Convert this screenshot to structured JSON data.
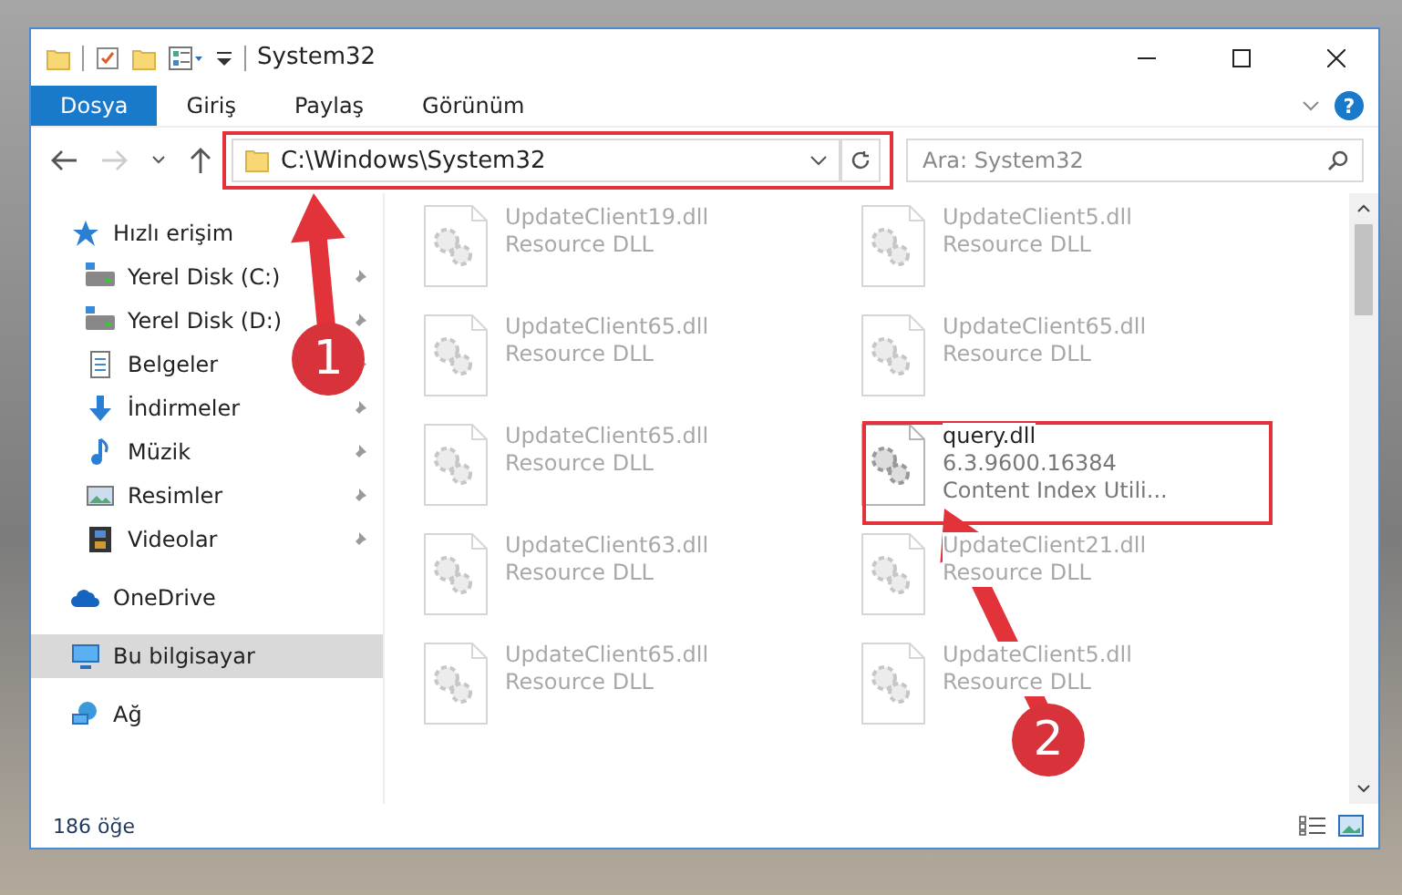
{
  "window": {
    "title": "System32"
  },
  "ribbon": {
    "tabs": [
      {
        "label": "Dosya",
        "selected": true
      },
      {
        "label": "Giriş",
        "selected": false
      },
      {
        "label": "Paylaş",
        "selected": false
      },
      {
        "label": "Görünüm",
        "selected": false
      }
    ],
    "help": "?"
  },
  "address": {
    "path": "C:\\Windows\\System32"
  },
  "search": {
    "placeholder": "Ara: System32"
  },
  "sidebar": {
    "items": [
      {
        "label": "Hızlı erişim",
        "kind": "star",
        "selected": false,
        "children": [
          {
            "label": "Yerel Disk (C:)",
            "kind": "drive",
            "pinned": true,
            "selected": false
          },
          {
            "label": "Yerel Disk (D:)",
            "kind": "drive",
            "pinned": true,
            "selected": false
          },
          {
            "label": "Belgeler",
            "kind": "docs",
            "pinned": true,
            "selected": false
          },
          {
            "label": "İndirmeler",
            "kind": "download",
            "pinned": true,
            "selected": false
          },
          {
            "label": "Müzik",
            "kind": "music",
            "pinned": true,
            "selected": false
          },
          {
            "label": "Resimler",
            "kind": "pictures",
            "pinned": true,
            "selected": false
          },
          {
            "label": "Videolar",
            "kind": "video",
            "pinned": true,
            "selected": false
          }
        ]
      },
      {
        "label": "OneDrive",
        "kind": "cloud",
        "selected": false
      },
      {
        "label": "Bu bilgisayar",
        "kind": "pc",
        "selected": true
      },
      {
        "label": "Ağ",
        "kind": "network",
        "selected": false
      }
    ]
  },
  "files": [
    {
      "name": "UpdateClient19.dll",
      "details": [
        "Resource DLL"
      ],
      "blurred": true
    },
    {
      "name": "UpdateClient5.dll",
      "details": [
        "Resource DLL"
      ],
      "blurred": true
    },
    {
      "name": "UpdateClient65.dll",
      "details": [
        "Resource DLL"
      ],
      "blurred": true
    },
    {
      "name": "UpdateClient65.dll",
      "details": [
        "Resource DLL"
      ],
      "blurred": true
    },
    {
      "name": "UpdateClient65.dll",
      "details": [
        "Resource DLL"
      ],
      "blurred": true
    },
    {
      "name": "query.dll",
      "details": [
        "6.3.9600.16384",
        "Content Index Utili..."
      ],
      "blurred": false
    },
    {
      "name": "UpdateClient63.dll",
      "details": [
        "Resource DLL"
      ],
      "blurred": true
    },
    {
      "name": "UpdateClient21.dll",
      "details": [
        "Resource DLL"
      ],
      "blurred": true
    },
    {
      "name": "UpdateClient65.dll",
      "details": [
        "Resource DLL"
      ],
      "blurred": true
    },
    {
      "name": "UpdateClient5.dll",
      "details": [
        "Resource DLL"
      ],
      "blurred": true
    }
  ],
  "status_bar": {
    "count": "186 öğe"
  },
  "annotations": [
    {
      "number": "1"
    },
    {
      "number": "2"
    }
  ]
}
